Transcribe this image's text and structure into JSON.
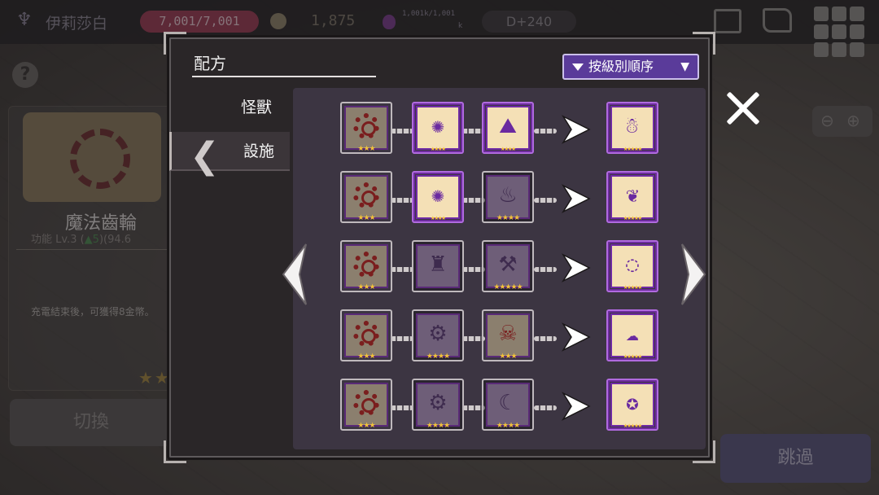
{
  "topbar": {
    "player_name": "伊莉莎白",
    "hp": "7,001/7,001",
    "gold": "1,875",
    "mana": "1,001k/1,001",
    "mana_unit": "k",
    "day": "D+240"
  },
  "info_panel": {
    "item_name": "魔法齒輪",
    "level_prefix": "功能 Lv.3 (",
    "level_up": "▲5",
    "level_suffix": ")(94.6",
    "description": "充電結束後，可獲得8金幣。",
    "stars": "★★★",
    "switch_label": "切換"
  },
  "skip_label": "跳過",
  "modal": {
    "title": "配方",
    "sort_label": "按級別順序",
    "sort_caret": "▼",
    "tabs": [
      {
        "label": "怪獸"
      },
      {
        "label": "設施"
      }
    ]
  },
  "recipes": [
    {
      "ingredients": [
        {
          "icon": "gear",
          "style": "plain",
          "stars": "★★★"
        },
        {
          "icon": "beast-claw",
          "style": "gold",
          "stars": "★★★★"
        },
        {
          "icon": "cave-mound",
          "style": "gold",
          "stars": "★★★★"
        }
      ],
      "result": {
        "icon": "snowman",
        "style": "gold",
        "stars": "★★★★★"
      }
    },
    {
      "ingredients": [
        {
          "icon": "gear",
          "style": "plain",
          "stars": "★★★"
        },
        {
          "icon": "beast-claw",
          "style": "gold",
          "stars": "★★★★"
        },
        {
          "icon": "campfire",
          "style": "dim",
          "stars": "★★★★"
        }
      ],
      "result": {
        "icon": "fire-spirit",
        "style": "gold",
        "stars": "★★★★★"
      }
    },
    {
      "ingredients": [
        {
          "icon": "gear",
          "style": "plain",
          "stars": "★★★"
        },
        {
          "icon": "totem",
          "style": "dim",
          "stars": ""
        },
        {
          "icon": "hammer-wrench",
          "style": "dim",
          "stars": "★★★★★"
        }
      ],
      "result": {
        "icon": "chain-ring",
        "style": "gold",
        "stars": "★★★★★"
      }
    },
    {
      "ingredients": [
        {
          "icon": "gear",
          "style": "plain",
          "stars": "★★★"
        },
        {
          "icon": "lock-gear",
          "style": "dim",
          "stars": "★★★★"
        },
        {
          "icon": "skull",
          "style": "plain",
          "stars": "★★★"
        }
      ],
      "result": {
        "icon": "ghost",
        "style": "gold",
        "stars": "★★★★★"
      }
    },
    {
      "ingredients": [
        {
          "icon": "gear",
          "style": "plain",
          "stars": "★★★"
        },
        {
          "icon": "lock-gear",
          "style": "dim",
          "stars": "★★★★"
        },
        {
          "icon": "moon-gear",
          "style": "dim",
          "stars": "★★★★"
        }
      ],
      "result": {
        "icon": "swirl-talisman",
        "style": "gold",
        "stars": "★★★★★"
      }
    }
  ],
  "colors": {
    "modal_bg": "#2a2628",
    "content_bg": "#3c3542",
    "sort_button": "#5a3b9a",
    "hp_pill": "#9a3c52",
    "star": "#f2c23a",
    "frame_purple": "#b06adf"
  }
}
